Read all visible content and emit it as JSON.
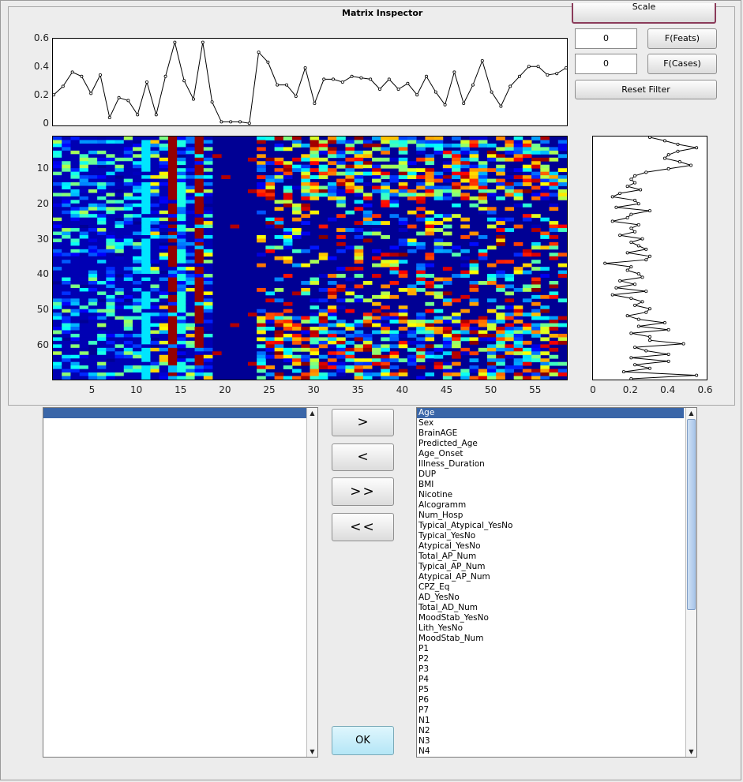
{
  "window": {
    "title": "Matrix Inspector"
  },
  "controls": {
    "scale_label": "Scale",
    "feats_value": "0",
    "feats_button": "F(Feats)",
    "cases_value": "0",
    "cases_button": "F(Cases)",
    "reset_button": "Reset Filter"
  },
  "top_plot": {
    "y_ticks": [
      "0.6",
      "0.4",
      "0.2",
      "0"
    ],
    "values": [
      0.21,
      0.27,
      0.37,
      0.34,
      0.22,
      0.35,
      0.05,
      0.19,
      0.17,
      0.07,
      0.3,
      0.07,
      0.34,
      0.58,
      0.31,
      0.18,
      0.58,
      0.16,
      0.02,
      0.02,
      0.02,
      0.01,
      0.51,
      0.44,
      0.28,
      0.28,
      0.2,
      0.4,
      0.15,
      0.32,
      0.32,
      0.3,
      0.34,
      0.33,
      0.32,
      0.25,
      0.32,
      0.25,
      0.29,
      0.21,
      0.34,
      0.23,
      0.14,
      0.37,
      0.15,
      0.28,
      0.45,
      0.23,
      0.13,
      0.27,
      0.34,
      0.41,
      0.41,
      0.35,
      0.36,
      0.4
    ]
  },
  "heatmap": {
    "y_ticks": [
      "10",
      "20",
      "30",
      "40",
      "50",
      "60"
    ],
    "x_ticks": [
      "5",
      "10",
      "15",
      "20",
      "25",
      "30",
      "35",
      "40",
      "45",
      "50",
      "55"
    ],
    "rows": 69,
    "cols": 58
  },
  "side_plot": {
    "x_ticks": [
      "0",
      "0.2",
      "0.4",
      "0.6"
    ],
    "values": [
      0.3,
      0.38,
      0.45,
      0.55,
      0.45,
      0.4,
      0.38,
      0.46,
      0.52,
      0.4,
      0.28,
      0.22,
      0.2,
      0.22,
      0.18,
      0.25,
      0.14,
      0.1,
      0.22,
      0.24,
      0.12,
      0.3,
      0.2,
      0.18,
      0.1,
      0.24,
      0.2,
      0.22,
      0.14,
      0.26,
      0.2,
      0.24,
      0.28,
      0.18,
      0.3,
      0.28,
      0.06,
      0.2,
      0.18,
      0.24,
      0.26,
      0.14,
      0.22,
      0.12,
      0.28,
      0.1,
      0.2,
      0.26,
      0.22,
      0.3,
      0.28,
      0.18,
      0.24,
      0.38,
      0.24,
      0.4,
      0.2,
      0.3,
      0.3,
      0.48,
      0.22,
      0.28,
      0.4,
      0.2,
      0.4,
      0.22,
      0.3,
      0.16,
      0.55,
      0.2
    ]
  },
  "left_list": {
    "items": [
      ""
    ]
  },
  "transfer": {
    "add": ">",
    "remove": "<",
    "add_all": ">>",
    "remove_all": "<<"
  },
  "right_list": {
    "items": [
      "Age",
      "Sex",
      "BrainAGE",
      "Predicted_Age",
      "Age_Onset",
      "Illness_Duration",
      "DUP",
      "BMI",
      "Nicotine",
      "Alcogramm",
      "Num_Hosp",
      "Typical_Atypical_YesNo",
      "Typical_YesNo",
      "Atypical_YesNo",
      "Total_AP_Num",
      "Typical_AP_Num",
      "Atypical_AP_Num",
      "CPZ_Eq",
      "AD_YesNo",
      "Total_AD_Num",
      "MoodStab_YesNo",
      "Lith_YesNo",
      "MoodStab_Num",
      "P1",
      "P2",
      "P3",
      "P4",
      "P5",
      "P6",
      "P7",
      "N1",
      "N2",
      "N3",
      "N4"
    ]
  },
  "ok_button": "OK",
  "colors": {
    "selection": "#3a66a8",
    "ok": "#c8eefa",
    "scale_border": "#8b3b5a"
  }
}
